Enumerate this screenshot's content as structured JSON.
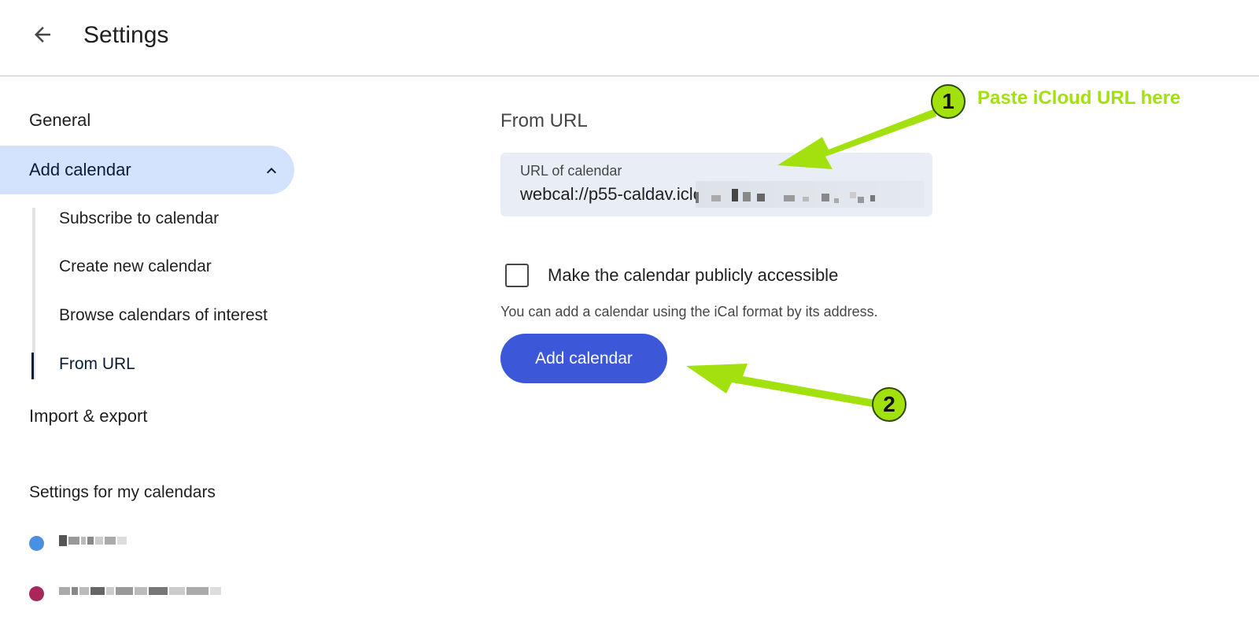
{
  "header": {
    "back_icon": "arrow-left-icon",
    "title": "Settings"
  },
  "sidebar": {
    "general": "General",
    "add_calendar": {
      "label": "Add calendar",
      "icon": "chevron-up-icon",
      "expanded": true
    },
    "sub_items": [
      {
        "label": "Subscribe to calendar"
      },
      {
        "label": "Create new calendar"
      },
      {
        "label": "Browse calendars of interest"
      },
      {
        "label": "From URL",
        "active": true
      }
    ],
    "import_export": "Import & export",
    "my_calendars_heading": "Settings for my calendars",
    "my_calendars": [
      {
        "color": "#4a90e2",
        "name_redacted": true
      },
      {
        "color": "#a8275a",
        "name_redacted": true
      }
    ]
  },
  "main": {
    "title": "From URL",
    "url_field": {
      "label": "URL of calendar",
      "value": "webcal://p55-caldav.icloud.com/"
    },
    "public_checkbox": {
      "label": "Make the calendar publicly accessible",
      "checked": false
    },
    "helper_text": "You can add a calendar using the iCal format by its address.",
    "add_button": "Add calendar"
  },
  "annotations": {
    "accent_color": "#a3e10e",
    "step1": {
      "number": "1",
      "text": "Paste iCloud URL here"
    },
    "step2": {
      "number": "2"
    }
  },
  "colors": {
    "active_nav_bg": "#d3e3fd",
    "primary_button": "#3c57d8",
    "field_bg": "#e9eef6"
  }
}
